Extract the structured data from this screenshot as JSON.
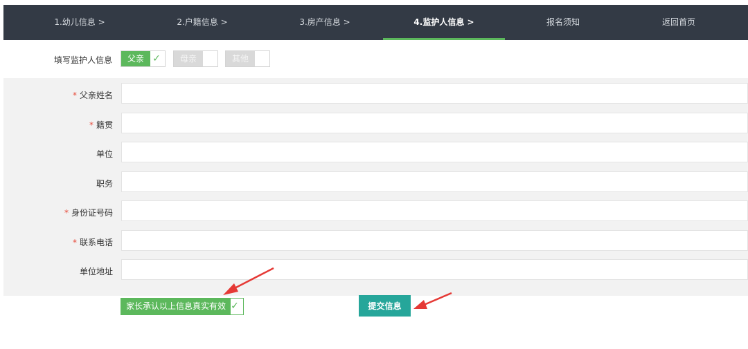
{
  "nav": {
    "items": [
      {
        "label": "1.幼儿信息 >"
      },
      {
        "label": "2.户籍信息 >"
      },
      {
        "label": "3.房产信息 >"
      },
      {
        "label": "4.监护人信息 >"
      },
      {
        "label": "报名须知"
      },
      {
        "label": "返回首页"
      }
    ],
    "active_index": 3
  },
  "guardian_select": {
    "label": "填写监护人信息",
    "options": [
      {
        "label": "父亲",
        "checked": true
      },
      {
        "label": "母亲",
        "checked": false
      },
      {
        "label": "其他",
        "checked": false
      }
    ]
  },
  "form": {
    "fields": [
      {
        "label": "父亲姓名",
        "required": true,
        "value": ""
      },
      {
        "label": "籍贯",
        "required": true,
        "value": ""
      },
      {
        "label": "单位",
        "required": false,
        "value": ""
      },
      {
        "label": "职务",
        "required": false,
        "value": ""
      },
      {
        "label": "身份证号码",
        "required": true,
        "value": ""
      },
      {
        "label": "联系电话",
        "required": true,
        "value": ""
      },
      {
        "label": "单位地址",
        "required": false,
        "value": ""
      }
    ],
    "required_mark": "*"
  },
  "agree": {
    "label": "家长承认以上信息真实有效",
    "checked": true
  },
  "submit": {
    "label": "提交信息"
  },
  "colors": {
    "nav_bg": "#333a45",
    "accent_green": "#5cb85c",
    "submit_teal": "#26a69a",
    "required_red": "#e74c3c",
    "annotation_arrow": "#e53935"
  }
}
